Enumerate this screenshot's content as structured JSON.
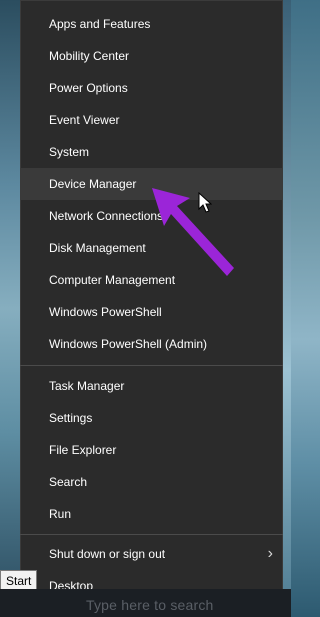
{
  "menu": {
    "items": [
      {
        "label": "Apps and Features",
        "active": false
      },
      {
        "label": "Mobility Center",
        "active": false
      },
      {
        "label": "Power Options",
        "active": false
      },
      {
        "label": "Event Viewer",
        "active": false
      },
      {
        "label": "System",
        "active": false
      },
      {
        "label": "Device Manager",
        "active": true
      },
      {
        "label": "Network Connections",
        "active": false
      },
      {
        "label": "Disk Management",
        "active": false
      },
      {
        "label": "Computer Management",
        "active": false
      },
      {
        "label": "Windows PowerShell",
        "active": false
      },
      {
        "label": "Windows PowerShell (Admin)",
        "active": false
      },
      {
        "label": "Task Manager",
        "active": false
      },
      {
        "label": "Settings",
        "active": false
      },
      {
        "label": "File Explorer",
        "active": false
      },
      {
        "label": "Search",
        "active": false
      },
      {
        "label": "Run",
        "active": false
      },
      {
        "label": "Shut down or sign out",
        "active": false,
        "has_submenu": true
      },
      {
        "label": "Desktop",
        "active": false
      }
    ]
  },
  "tooltip": {
    "label": "Start"
  },
  "taskbar": {
    "search_text": "Type here to search"
  },
  "colors": {
    "menu_bg": "#2b2b2b",
    "menu_active_bg": "#3a3a3a",
    "menu_text": "#ffffff",
    "separator": "#4b4b4b",
    "annotation_arrow": "#9b25d8"
  },
  "icons": {
    "submenu": "chevron-right-icon",
    "cursor": "mouse-pointer-icon",
    "annotation": "purple-arrow-icon"
  }
}
